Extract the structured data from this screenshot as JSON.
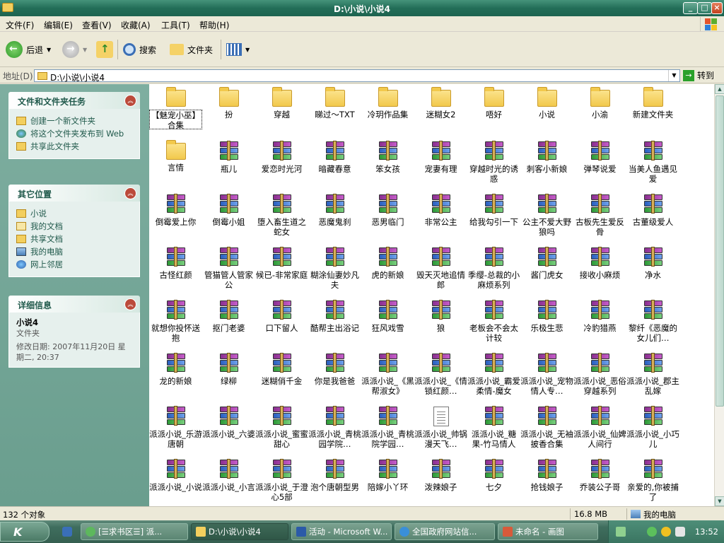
{
  "window": {
    "title": "D:\\小说\\小说4"
  },
  "menu": [
    "文件(F)",
    "编辑(E)",
    "查看(V)",
    "收藏(A)",
    "工具(T)",
    "帮助(H)"
  ],
  "toolbar": {
    "back": "后退",
    "search": "搜索",
    "folders": "文件夹"
  },
  "address": {
    "label": "地址(D)",
    "value": "D:\\小说\\小说4",
    "go": "转到"
  },
  "tasks_panel": {
    "title": "文件和文件夹任务",
    "items": [
      "创建一个新文件夹",
      "将这个文件夹发布到 Web",
      "共享此文件夹"
    ]
  },
  "places_panel": {
    "title": "其它位置",
    "items": [
      "小说",
      "我的文档",
      "共享文档",
      "我的电脑",
      "网上邻居"
    ]
  },
  "details_panel": {
    "title": "详细信息",
    "name": "小说4",
    "type": "文件夹",
    "modified": "修改日期: 2007年11月20日 星期二, 20:37"
  },
  "files": [
    {
      "name": "【魅宠小巫】合集",
      "type": "folder"
    },
    {
      "name": "扮",
      "type": "folder"
    },
    {
      "name": "穿越",
      "type": "folder"
    },
    {
      "name": "睇过～TXT",
      "type": "folder"
    },
    {
      "name": "冷玥作品集",
      "type": "folder"
    },
    {
      "name": "迷糊女2",
      "type": "folder"
    },
    {
      "name": "唔好",
      "type": "folder"
    },
    {
      "name": "小说",
      "type": "folder"
    },
    {
      "name": "小渝",
      "type": "folder"
    },
    {
      "name": "新建文件夹",
      "type": "folder"
    },
    {
      "name": "言情",
      "type": "folder"
    },
    {
      "name": "瓶儿",
      "type": "rar"
    },
    {
      "name": "爱恋时光河",
      "type": "rar"
    },
    {
      "name": "暗藏春意",
      "type": "rar"
    },
    {
      "name": "笨女孩",
      "type": "rar"
    },
    {
      "name": "宠妻有理",
      "type": "rar"
    },
    {
      "name": "穿越时光的诱惑",
      "type": "rar"
    },
    {
      "name": "刺客小新娘",
      "type": "rar"
    },
    {
      "name": "弹琴说爱",
      "type": "rar"
    },
    {
      "name": "当美人鱼遇见爱",
      "type": "rar"
    },
    {
      "name": "倒霉爱上你",
      "type": "rar"
    },
    {
      "name": "倒霉小姐",
      "type": "rar"
    },
    {
      "name": "堕入畜生道之蛇女",
      "type": "rar"
    },
    {
      "name": "恶魔鬼刹",
      "type": "rar"
    },
    {
      "name": "恶男临门",
      "type": "rar"
    },
    {
      "name": "非常公主",
      "type": "rar"
    },
    {
      "name": "给我勾引一下",
      "type": "rar"
    },
    {
      "name": "公主不爱大野狼吗",
      "type": "rar"
    },
    {
      "name": "古板先生爱反骨",
      "type": "rar"
    },
    {
      "name": "古董级爱人",
      "type": "rar"
    },
    {
      "name": "古怪红颜",
      "type": "rar"
    },
    {
      "name": "管猫管人管家公",
      "type": "rar"
    },
    {
      "name": "候已-非常家庭",
      "type": "rar"
    },
    {
      "name": "糊涂仙妻妙凡夫",
      "type": "rar"
    },
    {
      "name": "虎的新娘",
      "type": "rar"
    },
    {
      "name": "毁天灭地追情郎",
      "type": "rar"
    },
    {
      "name": "季缨-总裁的小麻烦系列",
      "type": "rar"
    },
    {
      "name": "酱门虎女",
      "type": "rar"
    },
    {
      "name": "接收小麻烦",
      "type": "rar"
    },
    {
      "name": "净水",
      "type": "rar"
    },
    {
      "name": "就想你投怀送抱",
      "type": "rar"
    },
    {
      "name": "抠门老婆",
      "type": "rar"
    },
    {
      "name": "口下留人",
      "type": "rar"
    },
    {
      "name": "酷帮主出浴记",
      "type": "rar"
    },
    {
      "name": "狂风戏雪",
      "type": "rar"
    },
    {
      "name": "狼",
      "type": "rar"
    },
    {
      "name": "老板会不会太计较",
      "type": "rar"
    },
    {
      "name": "乐极生悲",
      "type": "rar"
    },
    {
      "name": "冷豹猎燕",
      "type": "rar"
    },
    {
      "name": "黎纤《恶魔的女儿们…",
      "type": "rar"
    },
    {
      "name": "龙的新娘",
      "type": "rar"
    },
    {
      "name": "绿柳",
      "type": "rar"
    },
    {
      "name": "迷糊俏千金",
      "type": "rar"
    },
    {
      "name": "你是我爸爸",
      "type": "rar"
    },
    {
      "name": "派派小说_《黑帮淑女》",
      "type": "rar"
    },
    {
      "name": "派派小说_《情锁红颜…",
      "type": "rar"
    },
    {
      "name": "派派小说_霸爱柔情-魔女",
      "type": "rar"
    },
    {
      "name": "派派小说_宠物情人专…",
      "type": "rar"
    },
    {
      "name": "派派小说_恶俗穿越系列",
      "type": "rar"
    },
    {
      "name": "派派小说_郡主乱嫁",
      "type": "rar"
    },
    {
      "name": "派派小说_乐游唐朝",
      "type": "rar"
    },
    {
      "name": "派派小说_六婆",
      "type": "rar"
    },
    {
      "name": "派派小说_蜜蜜甜心",
      "type": "rar"
    },
    {
      "name": "派派小说_青桃园学院…",
      "type": "rar"
    },
    {
      "name": "派派小说_青桃院学园…",
      "type": "rar"
    },
    {
      "name": "派派小说_帅锅漫天飞…",
      "type": "txt"
    },
    {
      "name": "派派小说_糖果-竹马情人",
      "type": "rar"
    },
    {
      "name": "派派小说_无袖披香合集",
      "type": "rar"
    },
    {
      "name": "派派小说_仙婢人间行",
      "type": "rar"
    },
    {
      "name": "派派小说_小巧儿",
      "type": "rar"
    },
    {
      "name": "派派小说_小说",
      "type": "rar"
    },
    {
      "name": "派派小说_小言",
      "type": "rar"
    },
    {
      "name": "派派小说_于澄心5部",
      "type": "rar"
    },
    {
      "name": "泡个唐朝型男",
      "type": "rar"
    },
    {
      "name": "陪嫁小丫环",
      "type": "rar"
    },
    {
      "name": "泼辣娘子",
      "type": "rar"
    },
    {
      "name": "七夕",
      "type": "rar"
    },
    {
      "name": "抢钱娘子",
      "type": "rar"
    },
    {
      "name": "乔装公子哥",
      "type": "rar"
    },
    {
      "name": "亲爱的,你被捕了",
      "type": "rar"
    }
  ],
  "status": {
    "count": "132 个对象",
    "size": "16.8 MB",
    "location": "我的电脑"
  },
  "taskbar": {
    "start": "K",
    "buttons": [
      "[☰求书区☰] 派...",
      "D:\\小说\\小说4",
      "活动 - Microsoft W...",
      "全国政府网站信...",
      "未命名 - 画图"
    ],
    "clock": "13:52"
  }
}
